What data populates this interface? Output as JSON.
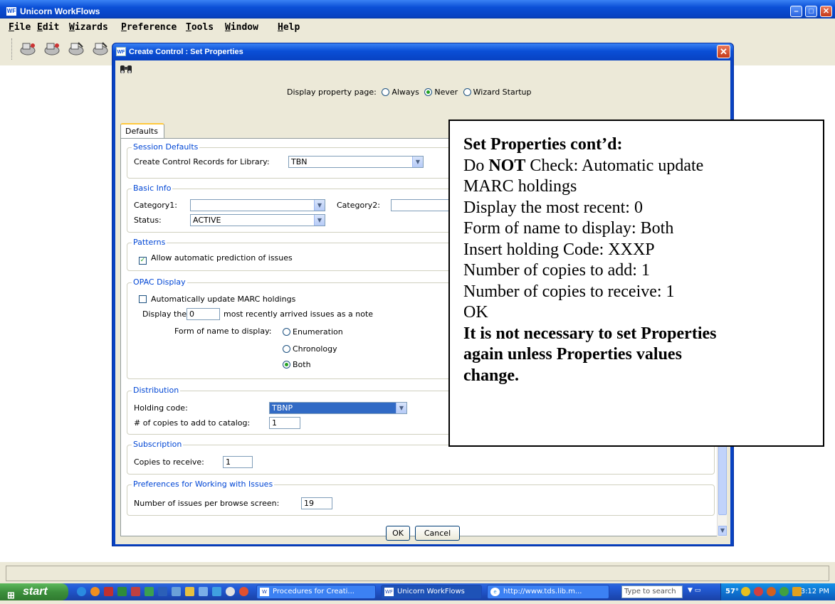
{
  "app": {
    "title": "Unicorn WorkFlows",
    "icon_text": "WF",
    "menu": [
      "File",
      "Edit",
      "Wizards",
      "Preference",
      "Tools",
      "Window",
      "Help"
    ]
  },
  "dialog": {
    "title": "Create Control : Set Properties",
    "display_property_label": "Display property page:",
    "display_options": [
      "Always",
      "Never",
      "Wizard Startup"
    ],
    "display_selected": "Never",
    "tab": "Defaults",
    "session_defaults": {
      "legend": "Session Defaults",
      "library_label": "Create Control Records for Library:",
      "library_value": "TBN"
    },
    "basic_info": {
      "legend": "Basic Info",
      "category1_label": "Category1:",
      "category1_value": "",
      "category2_label": "Category2:",
      "category2_value": "",
      "status_label": "Status:",
      "status_value": "ACTIVE"
    },
    "patterns": {
      "legend": "Patterns",
      "auto_predict_label": "Allow automatic prediction of issues",
      "auto_predict_checked": true
    },
    "opac": {
      "legend": "OPAC Display",
      "auto_update_label": "Automatically update MARC holdings",
      "auto_update_checked": false,
      "display_the_label": "Display the",
      "recent_value": "0",
      "recent_suffix": "most recently arrived issues as a note",
      "form_label": "Form of name to display:",
      "form_options": [
        "Enumeration",
        "Chronology",
        "Both"
      ],
      "form_selected": "Both"
    },
    "distribution": {
      "legend": "Distribution",
      "holding_label": "Holding code:",
      "holding_value": "TBNP",
      "copies_label": "# of copies to add to catalog:",
      "copies_value": "1"
    },
    "subscription": {
      "legend": "Subscription",
      "receive_label": "Copies to receive:",
      "receive_value": "1"
    },
    "preferences": {
      "legend": "Preferences for Working with Issues",
      "browse_label": "Number of issues per browse screen:",
      "browse_value": "19"
    },
    "ok_label": "OK",
    "cancel_label": "Cancel"
  },
  "callout": {
    "heading": "Set Properties cont’d:",
    "line1_pre": "Do ",
    "line1_bold": "NOT",
    "line1_post": " Check: Automatic update",
    "line2": "MARC holdings",
    "line3": "Display the most recent: 0",
    "line4": "Form of name to display: Both",
    "line5": "Insert holding Code: XXXP",
    "line6": "Number of copies to add: 1",
    "line7": "Number of copies to receive: 1",
    "line8": "OK",
    "note1": "It is not necessary to set Properties",
    "note2": "again unless Properties values",
    "note3": "change."
  },
  "taskbar": {
    "start_label": "start",
    "tasks": [
      "Procedures for Creati...",
      "Unicorn WorkFlows",
      "http://www.tds.lib.m..."
    ],
    "search_placeholder": "Type to search",
    "temperature": "57°",
    "clock": "3:12 PM"
  },
  "colors": {
    "titlebar": "#0a4fd6",
    "group_label": "#0046d5",
    "selection": "#316ac5",
    "taskbar": "#245edb",
    "start": "#3c8f3c"
  }
}
